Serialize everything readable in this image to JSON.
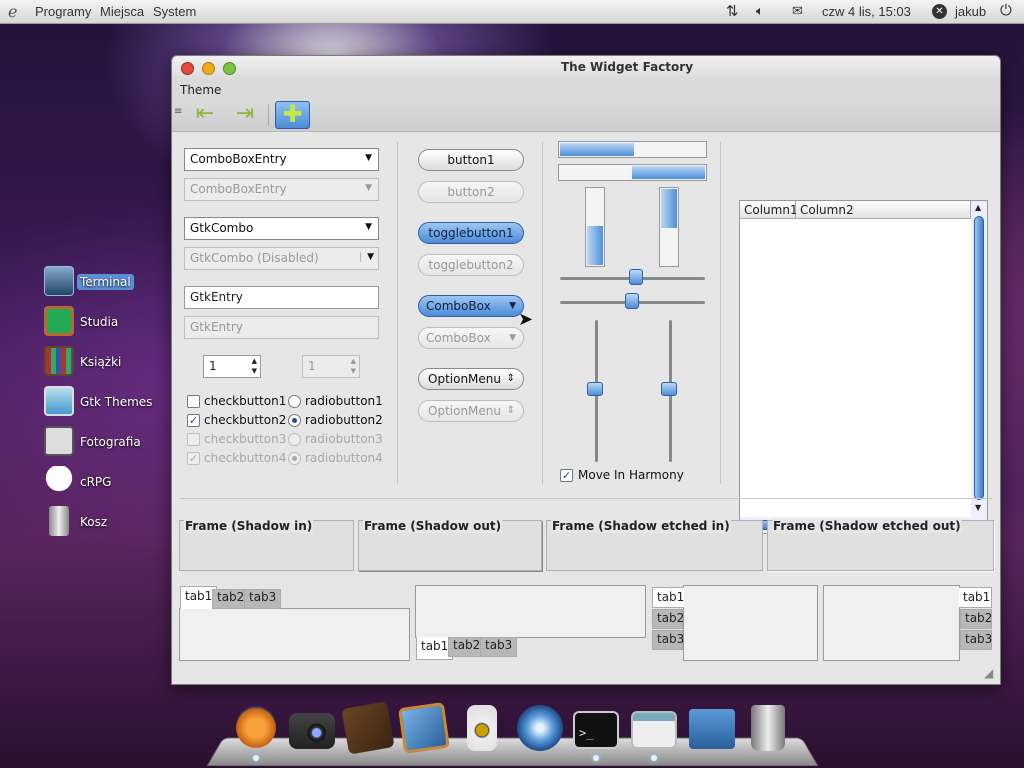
{
  "panel": {
    "menu": [
      "Programy",
      "Miejsca",
      "System"
    ],
    "clock": "czw  4 lis, 15:03",
    "user": "jakub"
  },
  "desktop_icons": [
    {
      "label": "Terminal",
      "icon": "terminal-icon",
      "selected": true
    },
    {
      "label": "Studia",
      "icon": "chalkboard-icon"
    },
    {
      "label": "Książki",
      "icon": "bookshelf-icon"
    },
    {
      "label": "Gtk Themes",
      "icon": "themes-icon"
    },
    {
      "label": "Fotografia",
      "icon": "photo-icon"
    },
    {
      "label": "cRPG",
      "icon": "skull-icon"
    },
    {
      "label": "Kosz",
      "icon": "trash-icon"
    }
  ],
  "window": {
    "title": "The Widget Factory",
    "menu": [
      "Theme"
    ]
  },
  "col1": {
    "combo_entry": "ComboBoxEntry",
    "combo_entry_dis": "ComboBoxEntry",
    "gtk_combo": "GtkCombo",
    "gtk_combo_dis": "GtkCombo (Disabled)",
    "entry": "GtkEntry",
    "entry_dis": "GtkEntry",
    "spin": "1",
    "spin_dis": "1",
    "checks": [
      "checkbutton1",
      "checkbutton2",
      "checkbutton3",
      "checkbutton4"
    ],
    "radios": [
      "radiobutton1",
      "radiobutton2",
      "radiobutton3",
      "radiobutton4"
    ]
  },
  "col2": {
    "button1": "button1",
    "button2": "button2",
    "toggle1": "togglebutton1",
    "toggle2": "togglebutton2",
    "combo": "ComboBox",
    "combo_dis": "ComboBox",
    "option": "OptionMenu",
    "option_dis": "OptionMenu"
  },
  "col3": {
    "harmony": "Move In Harmony",
    "hbar1": 0.5,
    "hbar2": 0.5,
    "vbar1": 0.5,
    "vbar2": 0.5
  },
  "tree": {
    "columns": [
      "Column1",
      "Column2"
    ]
  },
  "frames": [
    "Frame (Shadow in)",
    "Frame (Shadow out)",
    "Frame (Shadow etched in)",
    "Frame (Shadow etched out)"
  ],
  "tabs": [
    "tab1",
    "tab2",
    "tab3"
  ],
  "colors": {
    "accent": "#4d8cd6"
  }
}
